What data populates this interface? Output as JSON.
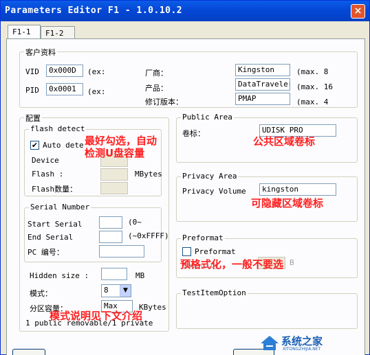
{
  "window": {
    "title": "Parameters Editor F1 - 1.0.10.2",
    "close": "×"
  },
  "tabs": [
    {
      "label": "F1-1"
    },
    {
      "label": "F1-2"
    }
  ],
  "customer": {
    "title": "客户资料",
    "vid_label": "VID",
    "vid_value": "0x000D",
    "vid_hint": "(ex:",
    "pid_label": "PID",
    "pid_value": "0x0001",
    "pid_hint": "(ex:",
    "vendor_label": "厂商：",
    "vendor_value": "Kingston",
    "vendor_max": "(max. 8",
    "product_label": "产品：",
    "product_value": "DataTraveler",
    "product_max": "(max. 16",
    "rev_label": "修订版本：",
    "rev_value": "PMAP",
    "rev_max": "(max. 4"
  },
  "config": {
    "title": "配置",
    "flash_detect": {
      "title": "flash detect",
      "auto_detect_label": "Auto dete",
      "auto_detect_checked": "✔",
      "device_label": "Device",
      "flash_label": "Flash :",
      "flash_unit": "MBytes",
      "flash_count_label": "Flash数量："
    },
    "serial": {
      "title": "Serial Number",
      "start_label": "Start Serial",
      "start_hint": "(0~",
      "end_label": "End Serial",
      "end_hint": "(~0xFFFF)",
      "pc_label": "PC 编号："
    },
    "hidden_label": "Hidden size :",
    "hidden_unit": "MB",
    "mode_label": "模式：",
    "mode_value": "8",
    "partition_label": "分区容量：",
    "partition_value": "Max",
    "partition_unit": "KBytes",
    "mode_desc": "1 public removable/1 private"
  },
  "public_area": {
    "title": "Public Area",
    "label": "卷标：",
    "value": "UDISK PRO"
  },
  "privacy_area": {
    "title": "Privacy Area",
    "label": "Privacy Volume",
    "value": "kingston"
  },
  "preformat": {
    "title": "Preformat",
    "checkbox_label": "Preformat",
    "capacity_label": "Capacity",
    "unit": "B"
  },
  "test_item": {
    "title": "TestItemOption"
  },
  "annotations": {
    "flash_note_1": "最好勾选，自动",
    "flash_note_2": "检测U盘容量",
    "public_note": "公共区域卷标",
    "privacy_note": "可隐藏区域卷标",
    "preformat_note": "预格式化，一般不要选",
    "mode_note": "模式说明见下文介绍"
  },
  "watermark": {
    "text": "系统之家",
    "sub": "XITONGZHIJIA.NET"
  },
  "colors": {
    "titlebar": "#0548d6",
    "annotation": "#ff2020",
    "panel": "#fcfcfe",
    "window": "#ece9d8"
  }
}
